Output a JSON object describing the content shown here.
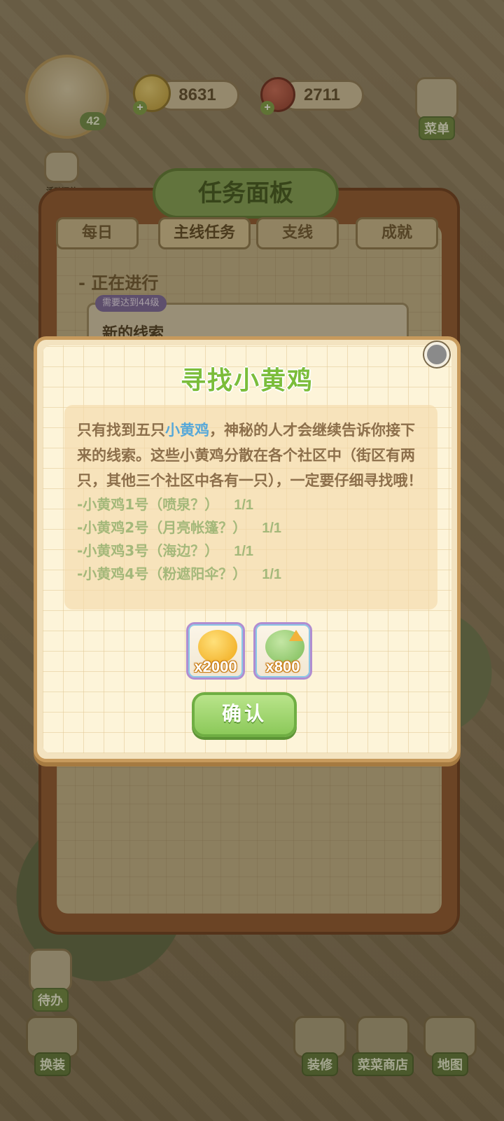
{
  "hud": {
    "level": "42",
    "coins": "8631",
    "food": "2711",
    "events_label": "活动汇总",
    "menu_label": "菜单"
  },
  "board": {
    "title": "任务面板",
    "tabs": [
      {
        "label": "每日"
      },
      {
        "label": "主线任务"
      },
      {
        "label": "支线"
      },
      {
        "label": "成就"
      }
    ],
    "section_label": "- 正在进行",
    "requirement": "需要达到44级",
    "task_title": "新的线索"
  },
  "modal": {
    "title": "寻找小黄鸡",
    "desc_before": "只有找到五只",
    "desc_highlight": "小黄鸡",
    "desc_after": "，神秘的人才会继续告诉你接下来的线索。这些小黄鸡分散在各个社区中（街区有两只，其他三个社区中各有一只），一定要仔细寻找哦！",
    "clues": [
      {
        "text": "-小黄鸡1号（喷泉？）",
        "progress": "1/1"
      },
      {
        "text": "-小黄鸡2号（月亮帐篷？）",
        "progress": "1/1"
      },
      {
        "text": "-小黄鸡3号（海边？）",
        "progress": "1/1"
      },
      {
        "text": "-小黄鸡4号（粉遮阳伞？）",
        "progress": "1/1"
      }
    ],
    "rewards": [
      {
        "icon": "gold-coins-icon",
        "amount": "x2000"
      },
      {
        "icon": "vegetable-upgrade-icon",
        "amount": "x800"
      }
    ],
    "confirm_label": "确认"
  },
  "nav": {
    "todo": "待办",
    "outfit": "换装",
    "decorate": "装修",
    "shop": "菜菜商店",
    "map": "地图"
  }
}
